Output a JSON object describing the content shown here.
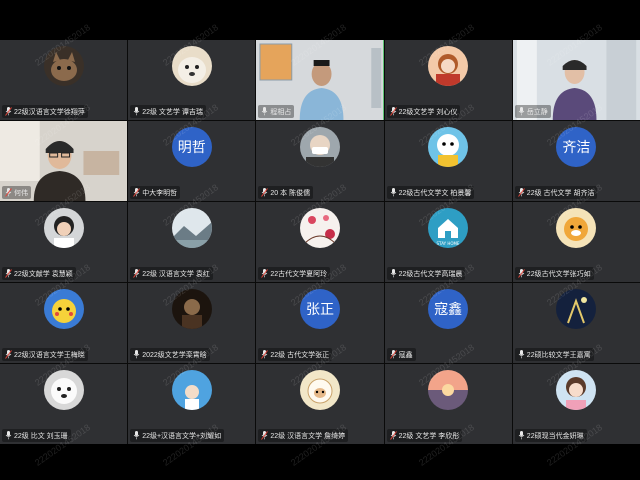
{
  "participants": [
    {
      "name": "22级汉语言文学徐翔萍",
      "avatar": "photo-cat",
      "muted": true
    },
    {
      "name": "22级 文艺学  谭吉瑞",
      "avatar": "photo-dog",
      "muted": false
    },
    {
      "name": "程相占",
      "avatar": "video-speaker",
      "muted": false,
      "active": true
    },
    {
      "name": "22级文艺学 刘心仪",
      "avatar": "photo-girl",
      "muted": true
    },
    {
      "name": "岳立静",
      "avatar": "video-woman",
      "muted": false
    },
    {
      "name": "何伟",
      "avatar": "video-man-glasses",
      "muted": true
    },
    {
      "name": "中大李明哲",
      "avatar_text": "明哲",
      "muted": true
    },
    {
      "name": "20 本  陈俊儒",
      "avatar": "photo-mask",
      "muted": true
    },
    {
      "name": "22级古代文学文 柏景馨",
      "avatar": "photo-cartoon",
      "muted": false
    },
    {
      "name": "22级 古代文学 胡齐洁",
      "avatar_text": "齐洁",
      "muted": true
    },
    {
      "name": "22级文献学 袁慧颖",
      "avatar": "photo-girl-helmet",
      "muted": true
    },
    {
      "name": "22级 汉语言文学 袁红",
      "avatar": "photo-landscape",
      "muted": true
    },
    {
      "name": "22古代文学夏阿玲",
      "avatar": "photo-flowers",
      "muted": true
    },
    {
      "name": "22级古代文学高瑞晨",
      "avatar": "photo-stay-home",
      "muted": false
    },
    {
      "name": "22级古代文学张巧如",
      "avatar": "photo-tiger",
      "muted": true
    },
    {
      "name": "22级汉语言文学王梅晓",
      "avatar": "photo-pikachu",
      "muted": true
    },
    {
      "name": "2022级文艺学栾霄晗",
      "avatar": "photo-dark",
      "muted": false
    },
    {
      "name": "22级 古代文学张正",
      "avatar_text": "张正",
      "muted": true
    },
    {
      "name": "寇鑫",
      "avatar_text": "寇鑫",
      "muted": true
    },
    {
      "name": "22硕比较文学王嘉寓",
      "avatar": "photo-night",
      "muted": false
    },
    {
      "name": "22级 比文 刘玉珊",
      "avatar": "photo-samoyed",
      "muted": false
    },
    {
      "name": "22级+汉语言文学+刘耀如",
      "avatar": "photo-sky",
      "muted": false
    },
    {
      "name": "22级 汉语言文学 詹绮婷",
      "avatar": "photo-sheep",
      "muted": true
    },
    {
      "name": "22级 文艺学  李欣彤",
      "avatar": "photo-sunset",
      "muted": true
    },
    {
      "name": "22硕现当代金妍琳",
      "avatar": "photo-girl2",
      "muted": false
    }
  ],
  "watermark": "2220201452018",
  "colors": {
    "tile_bg": "#2f3033",
    "active_border": "#3fbf5a",
    "text_avatar": "#2f63c7"
  }
}
